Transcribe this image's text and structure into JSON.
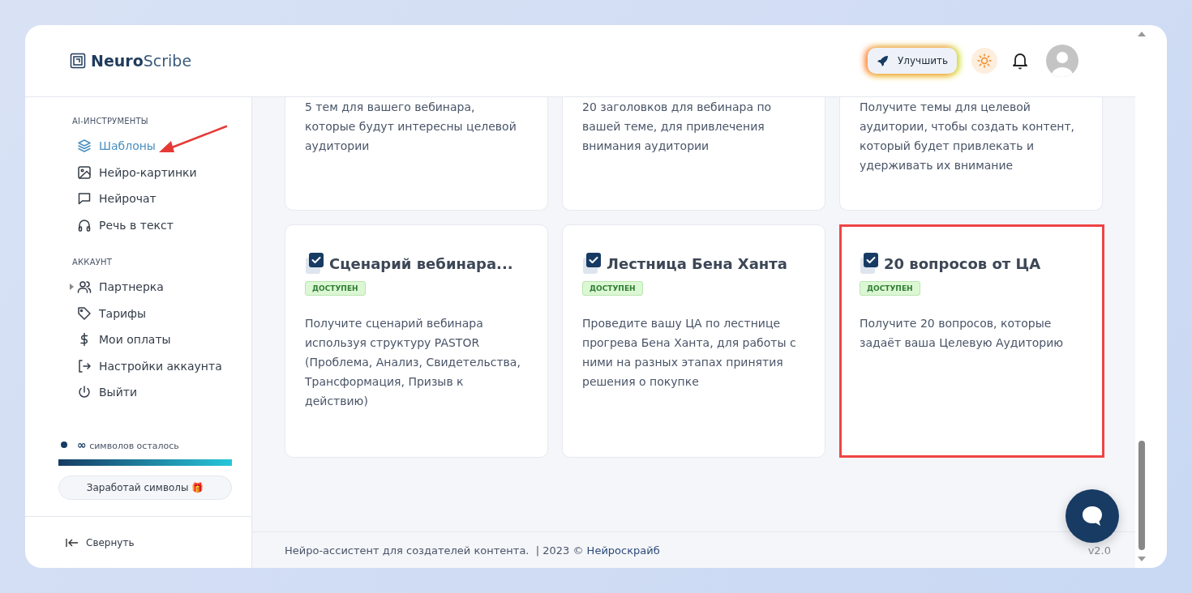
{
  "logo": {
    "bold": "Neuro",
    "light": "Scribe"
  },
  "header": {
    "upgrade_button": "Улучшить"
  },
  "sidebar": {
    "sections": [
      {
        "title": "AI-ИНСТРУМЕНТЫ",
        "items": [
          {
            "label": "Шаблоны",
            "selected": true,
            "pointed": true
          },
          {
            "label": "Нейро-картинки",
            "selected": false,
            "pointed": false
          },
          {
            "label": "Нейрочат",
            "selected": false,
            "pointed": false
          },
          {
            "label": "Речь в текст",
            "selected": false,
            "pointed": false
          }
        ]
      },
      {
        "title": "АККАУНТ",
        "items": [
          {
            "label": "Партнерка",
            "selected": false,
            "pointed": false,
            "expanded": false
          },
          {
            "label": "Тарифы",
            "selected": false,
            "pointed": false
          },
          {
            "label": "Мои оплаты",
            "selected": false,
            "pointed": false
          },
          {
            "label": "Настройки аккаунта",
            "selected": false,
            "pointed": false
          },
          {
            "label": "Выйти",
            "selected": false,
            "pointed": false
          }
        ]
      }
    ],
    "symbols": {
      "amount": "∞",
      "label": "символов осталось",
      "level": 1
    },
    "earn_button": "Заработай символы 🎁",
    "collapse": "Свернуть"
  },
  "cards_top": [
    {
      "description": "5 тем для вашего вебинара, которые будут интересны целевой аудитории"
    },
    {
      "description": "20 заголовков для вебинара по вашей теме, для привлечения внимания аудитории"
    },
    {
      "description": "Получите темы для целевой аудитории, чтобы создать контент, который будет привлекать и удерживать их внимание"
    }
  ],
  "cards": [
    {
      "title": "Сценарий вебинара...",
      "badge": "ДОСТУПЕН",
      "description": "Получите сценарий вебинара используя структуру PASTOR (Проблема, Анализ, Свидетельства, Трансформация, Призыв к действию)",
      "highlighted": false
    },
    {
      "title": "Лестница Бена Ханта",
      "badge": "ДОСТУПЕН",
      "description": "Проведите вашу ЦА по лестнице прогрева Бена Ханта, для работы с ними на разных этапах принятия решения о покупке",
      "highlighted": false
    },
    {
      "title": "20 вопросов от ЦА",
      "badge": "ДОСТУПЕН",
      "description": "Получите 20 вопросов, которые задаёт ваша Целевую Аудиторию",
      "highlighted": true
    }
  ],
  "footer": {
    "text": "Нейро-ассистент для создателей контента.  | 2023 © ",
    "link": "Нейроскрайб",
    "version": "v2.0"
  }
}
